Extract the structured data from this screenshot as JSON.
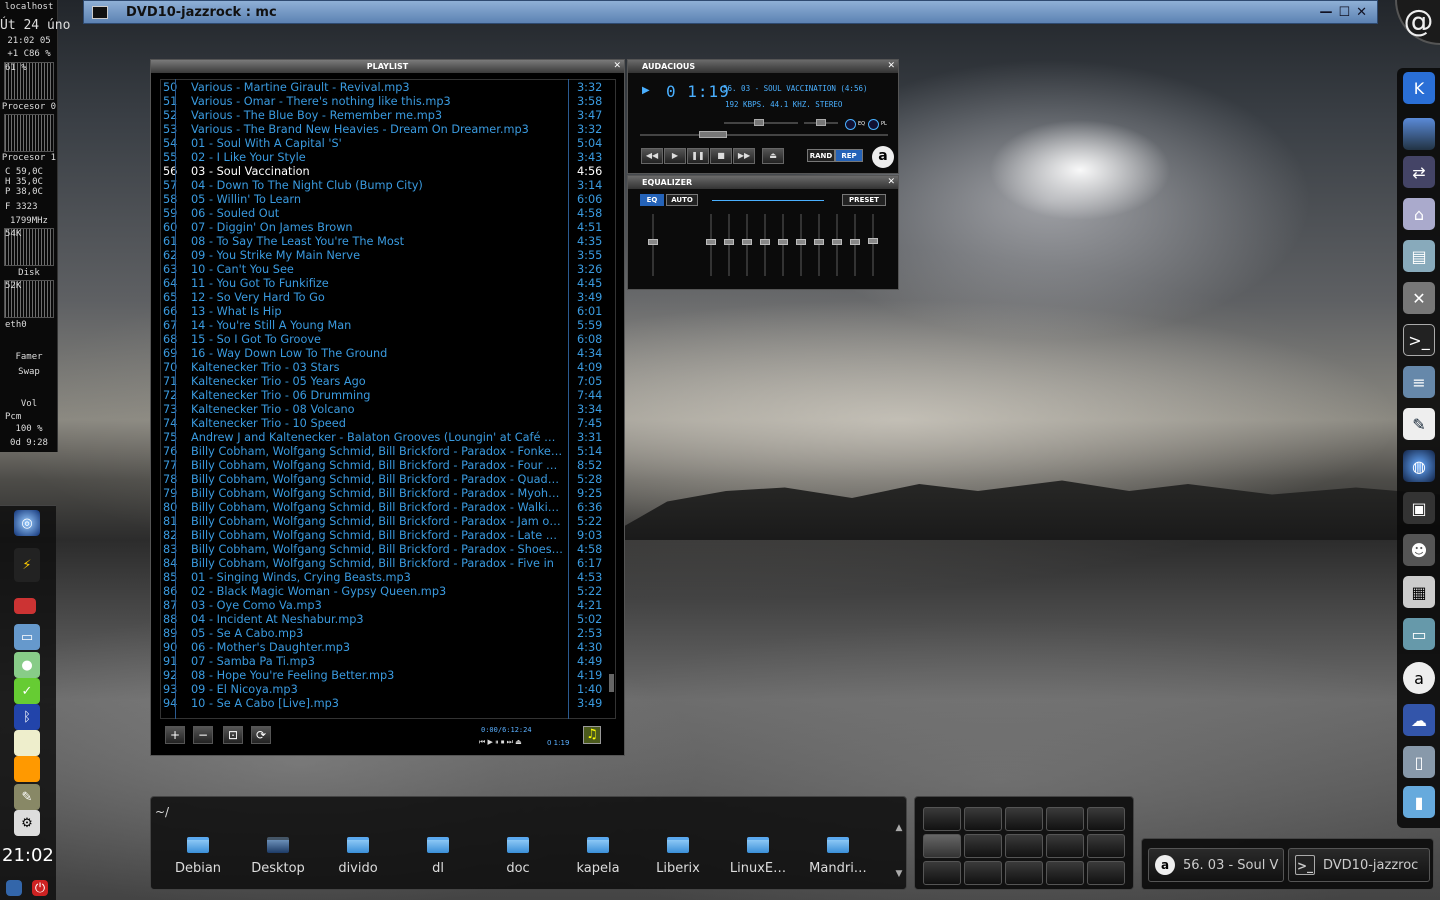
{
  "mc_window": {
    "title": "DVD10-jazzrock : mc",
    "btn_min": "—",
    "btn_max": "☐",
    "btn_close": "✕"
  },
  "sysmon": {
    "host": "localhost",
    "date_line": "Út 24 úno",
    "time_line": "21:02 05",
    "load_line": "+1 C86 %",
    "cpu_pct": "61 %",
    "proc0": "Procesor 0",
    "proc1": "Procesor 1",
    "temp_c": "C   59,0C",
    "temp_h": "H   35,0C",
    "temp_p": "P   38,0C",
    "fan": "F       3323",
    "freq": "1799MHz",
    "disk_rate": "54K",
    "disk": "Disk",
    "net_rate": "52K",
    "net": "eth0",
    "famer": "Famer",
    "swap": "Swap",
    "vol": "Vol",
    "pcm": "Pcm",
    "vol_pct": "100 %",
    "uptime": "0d  9:28"
  },
  "left_clock": "21:02",
  "playlist": {
    "title": "PLAYLIST",
    "close": "✕",
    "rows": [
      {
        "n": "50",
        "t": "Various - Martine Girault - Revival.mp3",
        "d": "3:32"
      },
      {
        "n": "51",
        "t": "Various - Omar - There's nothing  like this.mp3",
        "d": "3:58"
      },
      {
        "n": "52",
        "t": "Various - The Blue Boy - Remember me.mp3",
        "d": "3:47"
      },
      {
        "n": "53",
        "t": "Various - The Brand New Heavies - Dream On Dreamer.mp3",
        "d": "3:32"
      },
      {
        "n": "54",
        "t": "01 - Soul With A Capital 'S'",
        "d": "5:04"
      },
      {
        "n": "55",
        "t": "02 - I Like Your Style",
        "d": "3:43"
      },
      {
        "n": "56",
        "t": "03 - Soul Vaccination",
        "d": "4:56"
      },
      {
        "n": "57",
        "t": "04 - Down To The Night Club (Bump City)",
        "d": "3:14"
      },
      {
        "n": "58",
        "t": "05 - Willin' To Learn",
        "d": "6:06"
      },
      {
        "n": "59",
        "t": "06 - Souled Out",
        "d": "4:58"
      },
      {
        "n": "60",
        "t": "07 - Diggin' On James Brown",
        "d": "4:51"
      },
      {
        "n": "61",
        "t": "08 - To Say The Least You're The Most",
        "d": "4:35"
      },
      {
        "n": "62",
        "t": "09 - You Strike My Main Nerve",
        "d": "3:55"
      },
      {
        "n": "63",
        "t": "10 - Can't You See",
        "d": "3:26"
      },
      {
        "n": "64",
        "t": "11 - You Got To Funkifize",
        "d": "4:45"
      },
      {
        "n": "65",
        "t": "12 - So Very Hard To Go",
        "d": "3:49"
      },
      {
        "n": "66",
        "t": "13 - What Is Hip",
        "d": "6:01"
      },
      {
        "n": "67",
        "t": "14 - You're Still A Young Man",
        "d": "5:59"
      },
      {
        "n": "68",
        "t": "15 - So I Got To Groove",
        "d": "6:08"
      },
      {
        "n": "69",
        "t": "16 - Way Down Low To The Ground",
        "d": "4:34"
      },
      {
        "n": "70",
        "t": "Kaltenecker Trio - 03 Stars",
        "d": "4:09"
      },
      {
        "n": "71",
        "t": "Kaltenecker Trio - 05 Years Ago",
        "d": "7:05"
      },
      {
        "n": "72",
        "t": "Kaltenecker Trio - 06 Drumming",
        "d": "7:44"
      },
      {
        "n": "73",
        "t": "Kaltenecker Trio - 08 Volcano",
        "d": "3:34"
      },
      {
        "n": "74",
        "t": "Kaltenecker Trio - 10 Speed",
        "d": "7:45"
      },
      {
        "n": "75",
        "t": "Andrew J and Kaltenecker - Balaton Grooves (Loungin' at Café Mó…",
        "d": "3:31"
      },
      {
        "n": "76",
        "t": "Billy Cobham, Wolfgang Schmid, Bill Brickford - Paradox - Fonkey…",
        "d": "5:14"
      },
      {
        "n": "77",
        "t": "Billy Cobham, Wolfgang Schmid, Bill Brickford - Paradox - Four m…",
        "d": "8:52"
      },
      {
        "n": "78",
        "t": "Billy Cobham, Wolfgang Schmid, Bill Brickford - Paradox - Quadrant",
        "d": "5:28"
      },
      {
        "n": "79",
        "t": "Billy Cobham, Wolfgang Schmid, Bill Brickford - Paradox - Myohm…",
        "d": "9:25"
      },
      {
        "n": "80",
        "t": "Billy Cobham, Wolfgang Schmid, Bill Brickford - Paradox - Walkin…",
        "d": "6:36"
      },
      {
        "n": "81",
        "t": "Billy Cobham, Wolfgang Schmid, Bill Brickford - Paradox - Jam o'j…",
        "d": "5:22"
      },
      {
        "n": "82",
        "t": "Billy Cobham, Wolfgang Schmid, Bill Brickford - Paradox - Late nite",
        "d": "9:03"
      },
      {
        "n": "83",
        "t": "Billy Cobham, Wolfgang Schmid, Bill Brickford - Paradox - Shoes i…",
        "d": "4:58"
      },
      {
        "n": "84",
        "t": "Billy Cobham, Wolfgang Schmid, Bill Brickford - Paradox - Five in",
        "d": "6:17"
      },
      {
        "n": "85",
        "t": "01 - Singing Winds, Crying Beasts.mp3",
        "d": "4:53"
      },
      {
        "n": "86",
        "t": "02 - Black Magic Woman - Gypsy Queen.mp3",
        "d": "5:22"
      },
      {
        "n": "87",
        "t": "03 - Oye Como Va.mp3",
        "d": "4:21"
      },
      {
        "n": "88",
        "t": "04 - Incident At Neshabur.mp3",
        "d": "5:02"
      },
      {
        "n": "89",
        "t": "05 - Se A Cabo.mp3",
        "d": "2:53"
      },
      {
        "n": "90",
        "t": "06 - Mother's Daughter.mp3",
        "d": "4:30"
      },
      {
        "n": "91",
        "t": "07 - Samba Pa Ti.mp3",
        "d": "4:49"
      },
      {
        "n": "92",
        "t": "08 - Hope You're Feeling Better.mp3",
        "d": "4:19"
      },
      {
        "n": "93",
        "t": "09 - El Nicoya.mp3",
        "d": "1:40"
      },
      {
        "n": "94",
        "t": "10 - Se A Cabo [Live].mp3",
        "d": "3:49"
      }
    ],
    "current_index": 6,
    "btn_add": "+",
    "btn_remove": "−",
    "btn_select": "⊡",
    "btn_misc": "⟳",
    "time_info": "0:00/6:12:24",
    "mini_controls": "⏮ ▶ ⏸ ⏹ ⏭ ⏏",
    "mini_time": "0 1:19"
  },
  "audacious": {
    "title": "AUDACIOUS",
    "close": "✕",
    "play_indicator": "▶",
    "time": "0 1:19",
    "song": "56. 03 - SOUL VACCINATION (4:56)",
    "info": "192 KBPS. 44.1 KHZ. STEREO",
    "eq_label": "EQ",
    "pl_label": "PL",
    "btn_prev": "◀◀",
    "btn_play": "▶",
    "btn_pause": "❚❚",
    "btn_stop": "■",
    "btn_next": "▶▶",
    "btn_eject": "⏏",
    "rand": "RAND",
    "rep": "REP",
    "logo": "a",
    "seek_fraction": 0.27
  },
  "equalizer": {
    "title": "EQUALIZER",
    "close": "✕",
    "on": "EQ",
    "auto": "AUTO",
    "preset": "PRESET",
    "preamp": 0.45,
    "bands": [
      0.45,
      0.45,
      0.45,
      0.45,
      0.45,
      0.45,
      0.45,
      0.45,
      0.45,
      0.42
    ]
  },
  "file_manager": {
    "path": "~/",
    "items": [
      "Debian",
      "Desktop",
      "divido",
      "dl",
      "doc",
      "kapela",
      "Liberix",
      "LinuxE…",
      "Mandri…"
    ],
    "scroll_up": "▲",
    "scroll_down": "▼"
  },
  "taskbar": {
    "tasks": [
      {
        "icon": "a",
        "label": "56. 03 - Soul V"
      },
      {
        "icon": ">_",
        "label": "DVD10-jazzroc"
      }
    ]
  },
  "corner_glyph": "@",
  "colors": {
    "playlist_text": "#3a9be0",
    "current_text": "#ffffff",
    "accent": "#4ab0ff"
  }
}
